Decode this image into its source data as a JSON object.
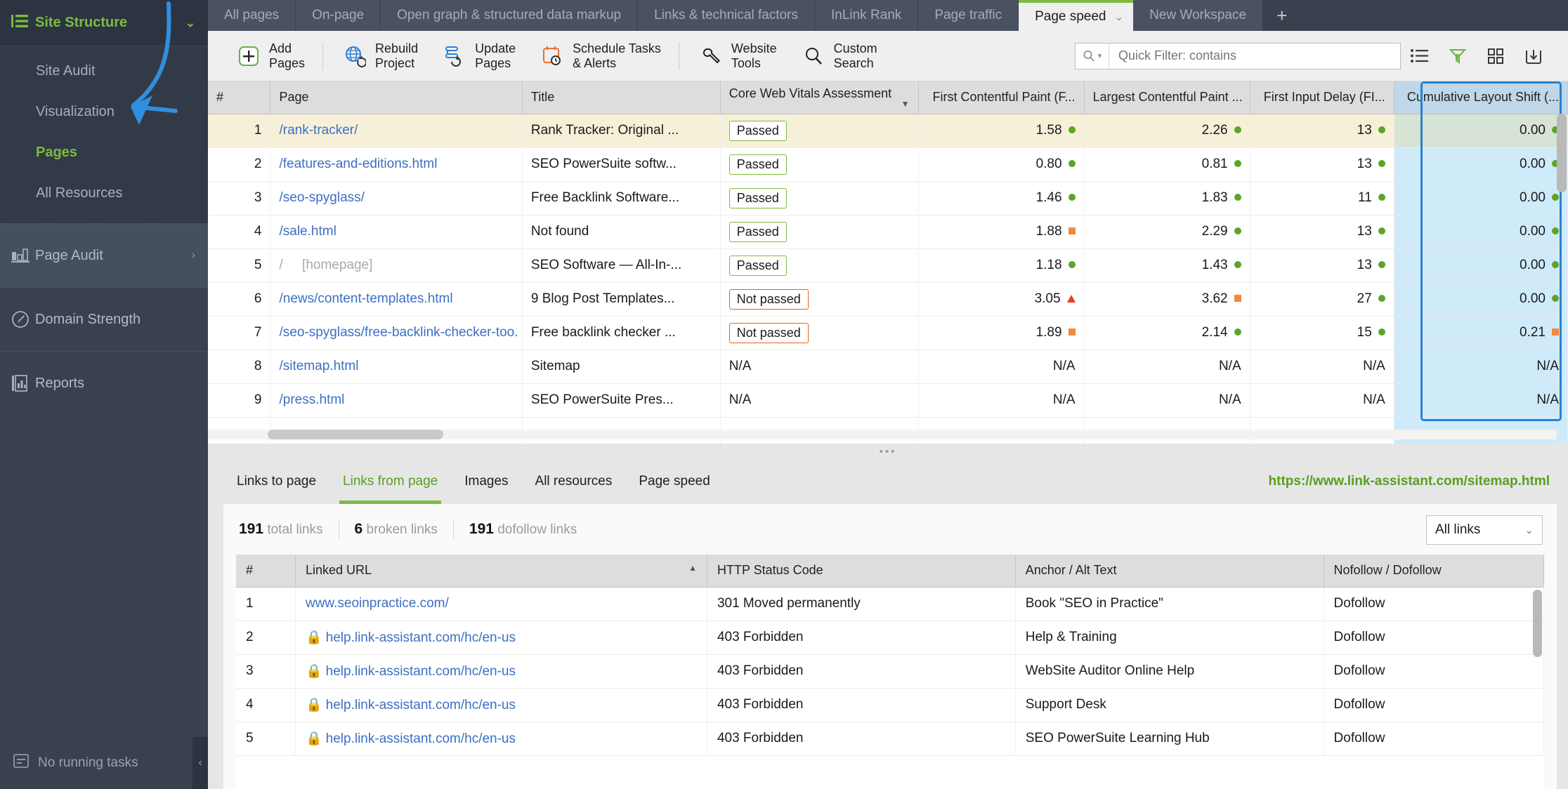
{
  "sidebar": {
    "group": {
      "label": "Site Structure",
      "icon": "list-icon",
      "chevron": "chevron-down-icon"
    },
    "sub_items": [
      {
        "label": "Site Audit",
        "active": false
      },
      {
        "label": "Visualization",
        "active": false
      },
      {
        "label": "Pages",
        "active": true
      },
      {
        "label": "All Resources",
        "active": false
      }
    ],
    "items": [
      {
        "label": "Page Audit",
        "icon": "bar-chart-icon",
        "arrow": "›"
      },
      {
        "label": "Domain Strength",
        "icon": "gauge-icon",
        "arrow": ""
      },
      {
        "label": "Reports",
        "icon": "report-icon",
        "arrow": ""
      }
    ],
    "footer": {
      "label": "No running tasks",
      "icon": "task-icon"
    },
    "collapse": "‹"
  },
  "tabs": [
    {
      "label": "All pages",
      "active": false
    },
    {
      "label": "On-page",
      "active": false
    },
    {
      "label": "Open graph & structured data markup",
      "active": false
    },
    {
      "label": "Links & technical factors",
      "active": false
    },
    {
      "label": "InLink Rank",
      "active": false
    },
    {
      "label": "Page traffic",
      "active": false
    },
    {
      "label": "Page speed",
      "active": true
    },
    {
      "label": "New Workspace",
      "active": false
    }
  ],
  "tab_add_label": "+",
  "toolbar": {
    "buttons": [
      {
        "label": "Add\nPages",
        "icon": "plus-box-icon"
      },
      {
        "label": "Rebuild\nProject",
        "icon": "globe-refresh-icon"
      },
      {
        "label": "Update\nPages",
        "icon": "pages-refresh-icon"
      },
      {
        "label": "Schedule Tasks\n& Alerts",
        "icon": "calendar-alarm-icon"
      },
      {
        "label": "Website\nTools",
        "icon": "wrench-icon"
      },
      {
        "label": "Custom\nSearch",
        "icon": "magnifier-icon"
      }
    ],
    "quick_filter_placeholder": "Quick Filter: contains",
    "quick_filter_value": "",
    "right_icons": [
      "list-view-icon",
      "filter-icon",
      "grid-view-icon",
      "export-icon"
    ]
  },
  "main_table": {
    "columns": [
      "#",
      "Page",
      "Title",
      "Core Web Vitals Assessment",
      "First Contentful Paint (F...",
      "Largest Contentful Paint ...",
      "First Input Delay (FI...",
      "Cumulative Layout Shift (..."
    ],
    "sorted_column": "Core Web Vitals Assessment",
    "sort_direction": "desc",
    "selected_column": "Cumulative Layout Shift (...",
    "rows": [
      {
        "n": "1",
        "page": "/rank-tracker/",
        "page_note": "",
        "title": "Rank Tracker: Original ...",
        "cwv": "Passed",
        "cwv_state": "pass",
        "fcp": "1.58",
        "fcp_mark": "dot",
        "lcp": "2.26",
        "lcp_mark": "dot",
        "fid": "13",
        "fid_mark": "dot",
        "cls": "0.00",
        "cls_mark": "dot"
      },
      {
        "n": "2",
        "page": "/features-and-editions.html",
        "page_note": "",
        "title": "SEO PowerSuite softw...",
        "cwv": "Passed",
        "cwv_state": "pass",
        "fcp": "0.80",
        "fcp_mark": "dot",
        "lcp": "0.81",
        "lcp_mark": "dot",
        "fid": "13",
        "fid_mark": "dot",
        "cls": "0.00",
        "cls_mark": "dot"
      },
      {
        "n": "3",
        "page": "/seo-spyglass/",
        "page_note": "",
        "title": "Free Backlink Software...",
        "cwv": "Passed",
        "cwv_state": "pass",
        "fcp": "1.46",
        "fcp_mark": "dot",
        "lcp": "1.83",
        "lcp_mark": "dot",
        "fid": "11",
        "fid_mark": "dot",
        "cls": "0.00",
        "cls_mark": "dot"
      },
      {
        "n": "4",
        "page": "/sale.html",
        "page_note": "",
        "title": "Not found",
        "title_muted": true,
        "cwv": "Passed",
        "cwv_state": "pass",
        "fcp": "1.88",
        "fcp_mark": "sq",
        "lcp": "2.29",
        "lcp_mark": "dot",
        "fid": "13",
        "fid_mark": "dot",
        "cls": "0.00",
        "cls_mark": "dot"
      },
      {
        "n": "5",
        "page": "/",
        "page_note": "[homepage]",
        "page_muted": true,
        "title": "SEO Software — All-In-...",
        "cwv": "Passed",
        "cwv_state": "pass",
        "fcp": "1.18",
        "fcp_mark": "dot",
        "lcp": "1.43",
        "lcp_mark": "dot",
        "fid": "13",
        "fid_mark": "dot",
        "cls": "0.00",
        "cls_mark": "dot"
      },
      {
        "n": "6",
        "page": "/news/content-templates.html",
        "page_note": "",
        "title": "9 Blog Post Templates...",
        "cwv": "Not passed",
        "cwv_state": "fail",
        "fcp": "3.05",
        "fcp_mark": "tri",
        "lcp": "3.62",
        "lcp_mark": "sq",
        "fid": "27",
        "fid_mark": "dot",
        "cls": "0.00",
        "cls_mark": "dot"
      },
      {
        "n": "7",
        "page": "/seo-spyglass/free-backlink-checker-too.",
        "page_note": "",
        "title": "Free backlink checker ...",
        "cwv": "Not passed",
        "cwv_state": "fail",
        "fcp": "1.89",
        "fcp_mark": "sq",
        "lcp": "2.14",
        "lcp_mark": "dot",
        "fid": "15",
        "fid_mark": "dot",
        "cls": "0.21",
        "cls_mark": "sq"
      },
      {
        "n": "8",
        "page": "/sitemap.html",
        "page_note": "",
        "title": "Sitemap",
        "cwv": "N/A",
        "cwv_state": "na",
        "fcp": "N/A",
        "fcp_mark": "",
        "lcp": "N/A",
        "lcp_mark": "",
        "fid": "N/A",
        "fid_mark": "",
        "cls": "N/A",
        "cls_mark": ""
      },
      {
        "n": "9",
        "page": "/press.html",
        "page_note": "",
        "title": "SEO PowerSuite Pres...",
        "cwv": "N/A",
        "cwv_state": "na",
        "fcp": "N/A",
        "fcp_mark": "",
        "lcp": "N/A",
        "lcp_mark": "",
        "fid": "N/A",
        "fid_mark": "",
        "cls": "N/A",
        "cls_mark": ""
      }
    ]
  },
  "bottom": {
    "tabs": [
      {
        "label": "Links to page",
        "active": false
      },
      {
        "label": "Links from page",
        "active": true
      },
      {
        "label": "Images",
        "active": false
      },
      {
        "label": "All resources",
        "active": false
      },
      {
        "label": "Page speed",
        "active": false
      }
    ],
    "url": "https://www.link-assistant.com/sitemap.html",
    "stats": [
      {
        "value": "191",
        "label": "total links"
      },
      {
        "value": "6",
        "label": "broken links"
      },
      {
        "value": "191",
        "label": "dofollow links"
      }
    ],
    "filter_select": "All links",
    "table": {
      "columns": [
        "#",
        "Linked URL",
        "HTTP Status Code",
        "Anchor / Alt Text",
        "Nofollow / Dofollow"
      ],
      "sorted_column": "Linked URL",
      "rows": [
        {
          "n": "1",
          "url": "www.seoinpractice.com/",
          "locked": false,
          "status": "301 Moved permanently",
          "anchor": "Book \"SEO in Practice\"",
          "follow": "Dofollow"
        },
        {
          "n": "2",
          "url": "help.link-assistant.com/hc/en-us",
          "locked": true,
          "status": "403 Forbidden",
          "anchor": "Help & Training",
          "follow": "Dofollow"
        },
        {
          "n": "3",
          "url": "help.link-assistant.com/hc/en-us",
          "locked": true,
          "status": "403 Forbidden",
          "anchor": "WebSite Auditor Online Help",
          "follow": "Dofollow"
        },
        {
          "n": "4",
          "url": "help.link-assistant.com/hc/en-us",
          "locked": true,
          "status": "403 Forbidden",
          "anchor": "Support Desk",
          "follow": "Dofollow"
        },
        {
          "n": "5",
          "url": "help.link-assistant.com/hc/en-us",
          "locked": true,
          "status": "403 Forbidden",
          "anchor": "SEO PowerSuite Learning Hub",
          "follow": "Dofollow"
        }
      ]
    }
  },
  "colors": {
    "accent_green": "#7cbb3f",
    "sidebar_bg": "#39414f",
    "link_blue": "#3c6fc4",
    "selection_blue": "#2c7fd0",
    "warn_orange": "#e8621a"
  }
}
